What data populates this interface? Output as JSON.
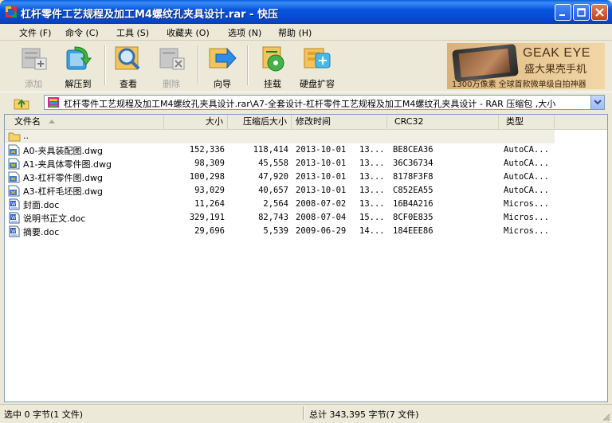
{
  "window": {
    "title": "杠杆零件工艺规程及加工M4螺纹孔夹具设计.rar - 快压",
    "minimize_label": "minimize",
    "maximize_label": "maximize",
    "close_label": "close"
  },
  "menu": [
    {
      "label": "文件 (F)"
    },
    {
      "label": "命令 (C)"
    },
    {
      "label": "工具 (S)"
    },
    {
      "label": "收藏夹 (O)"
    },
    {
      "label": "选项 (N)"
    },
    {
      "label": "帮助 (H)"
    }
  ],
  "toolbar": {
    "add": "添加",
    "extract": "解压到",
    "view": "查看",
    "delete": "删除",
    "wizard": "向导",
    "mount": "挂载",
    "disk_expand": "硬盘扩容"
  },
  "ad": {
    "brand": "GEAK EYE",
    "brand_cn": "盛大果壳手机",
    "slogan": "1300万像素 全球首款微单级自拍神器"
  },
  "address": {
    "path": "杠杆零件工艺规程及加工M4螺纹孔夹具设计.rar\\A7-全套设计-杠杆零件工艺规程及加工M4螺纹孔夹具设计 - RAR 压缩包 ,大小"
  },
  "columns": {
    "name": "文件名",
    "size": "大小",
    "packed": "压缩后大小",
    "modified": "修改时间",
    "crc": "CRC32",
    "type": "类型"
  },
  "parent_row": {
    "name": ".."
  },
  "files": [
    {
      "name": "A0-夹具装配图.dwg",
      "size": "152,336",
      "packed": "118,414",
      "date": "2013-10-01",
      "time": "13...",
      "crc": "BE8CEA36",
      "type": "AutoCA...",
      "icon": "dwg-file-icon"
    },
    {
      "name": "A1-夹具体零件图.dwg",
      "size": "98,309",
      "packed": "45,558",
      "date": "2013-10-01",
      "time": "13...",
      "crc": "36C36734",
      "type": "AutoCA...",
      "icon": "dwg-file-icon"
    },
    {
      "name": "A3-杠杆零件图.dwg",
      "size": "100,298",
      "packed": "47,920",
      "date": "2013-10-01",
      "time": "13...",
      "crc": "8178F3F8",
      "type": "AutoCA...",
      "icon": "dwg-file-icon"
    },
    {
      "name": "A3-杠杆毛坯图.dwg",
      "size": "93,029",
      "packed": "40,657",
      "date": "2013-10-01",
      "time": "13...",
      "crc": "C852EA55",
      "type": "AutoCA...",
      "icon": "dwg-file-icon"
    },
    {
      "name": "封面.doc",
      "size": "11,264",
      "packed": "2,564",
      "date": "2008-07-02",
      "time": "13...",
      "crc": "16B4A216",
      "type": "Micros...",
      "icon": "doc-file-icon"
    },
    {
      "name": "说明书正文.doc",
      "size": "329,191",
      "packed": "82,743",
      "date": "2008-07-04",
      "time": "15...",
      "crc": "8CF0E835",
      "type": "Micros...",
      "icon": "doc-file-icon"
    },
    {
      "name": "摘要.doc",
      "size": "29,696",
      "packed": "5,539",
      "date": "2009-06-29",
      "time": "14...",
      "crc": "184EEE86",
      "type": "Micros...",
      "icon": "doc-file-icon"
    }
  ],
  "status": {
    "selected": "选中   0 字节(1 文件)",
    "total": "总计   343,395 字节(7 文件)"
  },
  "colors": {
    "titlebar": "#0855dd",
    "chrome": "#ece9d8",
    "list_border": "#7f9db9"
  }
}
